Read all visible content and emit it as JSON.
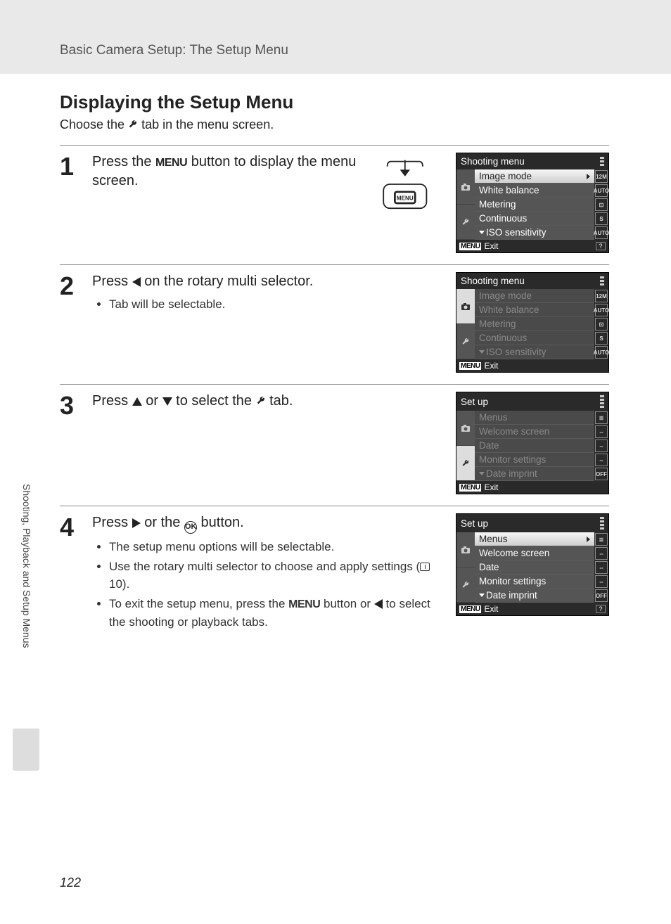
{
  "header": "Basic Camera Setup: The Setup Menu",
  "title": "Displaying the Setup Menu",
  "subtitle_pre": "Choose the ",
  "subtitle_post": " tab in the menu screen.",
  "steps": {
    "s1": {
      "num": "1",
      "text_pre": "Press the ",
      "text_post": " button to display the menu screen.",
      "menu_word": "MENU"
    },
    "s2": {
      "num": "2",
      "text_pre": "Press ",
      "text_post": " on the rotary multi selector.",
      "bullet1": "Tab will be selectable."
    },
    "s3": {
      "num": "3",
      "text_pre": "Press ",
      "text_mid": " or ",
      "text_post": " to select the ",
      "text_end": " tab."
    },
    "s4": {
      "num": "4",
      "text_pre": "Press ",
      "text_mid": " or the ",
      "text_post": " button.",
      "ok": "OK",
      "b1": "The setup menu options will be selectable.",
      "b2_pre": "Use the rotary multi selector to choose and apply settings (",
      "b2_ref": "10",
      "b2_post": ").",
      "b3_pre": "To exit the setup menu, press the ",
      "b3_menu": "MENU",
      "b3_mid": " button or ",
      "b3_post": " to select the shooting or playback tabs."
    }
  },
  "lcd1": {
    "title": "Shooting menu",
    "items": [
      "Image mode",
      "White balance",
      "Metering",
      "Continuous",
      "ISO sensitivity"
    ],
    "badges": [
      "12M",
      "AUTO",
      "⊡",
      "S",
      "AUTO"
    ],
    "exit": "Exit"
  },
  "lcd2": {
    "title": "Shooting menu",
    "items": [
      "Image mode",
      "White balance",
      "Metering",
      "Continuous",
      "ISO sensitivity"
    ],
    "badges": [
      "12M",
      "AUTO",
      "⊡",
      "S",
      "AUTO"
    ],
    "exit": "Exit"
  },
  "lcd3": {
    "title": "Set up",
    "items": [
      "Menus",
      "Welcome screen",
      "Date",
      "Monitor settings",
      "Date imprint"
    ],
    "badges": [
      "≣",
      "--",
      "--",
      "--",
      "OFF"
    ],
    "exit": "Exit"
  },
  "lcd4": {
    "title": "Set up",
    "items": [
      "Menus",
      "Welcome screen",
      "Date",
      "Monitor settings",
      "Date imprint"
    ],
    "badges": [
      "≣",
      "--",
      "--",
      "--",
      "OFF"
    ],
    "exit": "Exit"
  },
  "menu_box": "MENU",
  "side_label": "Shooting, Playback and Setup Menus",
  "page_number": "122"
}
